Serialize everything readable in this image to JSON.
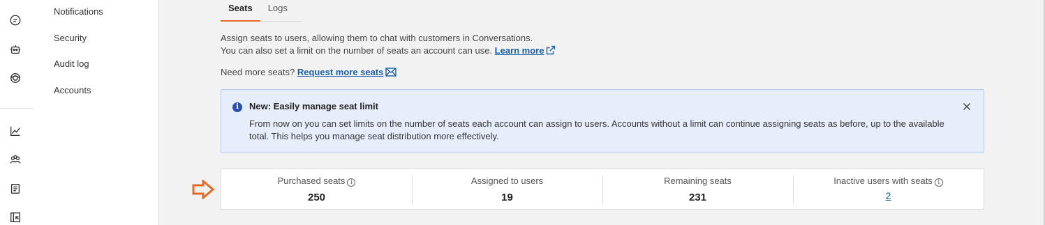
{
  "subnav": {
    "items": [
      {
        "label": "Notifications"
      },
      {
        "label": "Security"
      },
      {
        "label": "Audit log"
      },
      {
        "label": "Accounts"
      }
    ]
  },
  "tabs": [
    {
      "label": "Seats",
      "active": true
    },
    {
      "label": "Logs",
      "active": false
    }
  ],
  "description": {
    "line1": "Assign seats to users, allowing them to chat with customers in Conversations.",
    "line2": "You can also set a limit on the number of seats an account can use.",
    "learn_more": "Learn more"
  },
  "more_seats": {
    "text": "Need more seats?",
    "link": "Request more seats"
  },
  "banner": {
    "icon": "i",
    "title": "New: Easily manage seat limit",
    "body": "From now on you can set limits on the number of seats each account can assign to users. Accounts without a limit can continue assigning seats as before, up to the available total. This helps you manage seat distribution more effectively."
  },
  "stats": {
    "purchased": {
      "label": "Purchased seats",
      "value": "250"
    },
    "assigned": {
      "label": "Assigned to users",
      "value": "19"
    },
    "remaining": {
      "label": "Remaining seats",
      "value": "231"
    },
    "inactive": {
      "label": "Inactive users with seats",
      "value": "2"
    }
  },
  "colors": {
    "accent": "#e56a26",
    "link": "#1a5fa8",
    "banner_bg": "#e7eefb"
  }
}
